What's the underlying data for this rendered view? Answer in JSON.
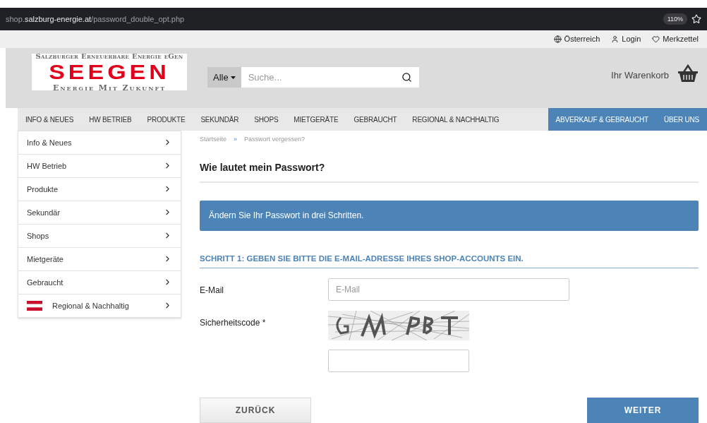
{
  "browser": {
    "url_host_prefix": "shop.",
    "url_domain": "salzburg-energie.at",
    "url_path": "/password_double_opt.php",
    "zoom": "110%"
  },
  "topbar": [
    {
      "label": "Österreich",
      "kind": "globe"
    },
    {
      "label": "Login",
      "kind": "user"
    },
    {
      "label": "Merkzettel",
      "kind": "heart"
    }
  ],
  "logo": {
    "top": "Salzburger Erneuerbare Energie eGen",
    "main": "SEEGEN",
    "bottom": "Energie Mit Zukunft"
  },
  "search": {
    "category": "Alle",
    "placeholder": "Suche..."
  },
  "cart": {
    "label": "Ihr Warenkorb"
  },
  "nav": [
    {
      "label": "INFO & NEUES",
      "highlighted": false
    },
    {
      "label": "HW BETRIEB",
      "highlighted": false
    },
    {
      "label": "PRODUKTE",
      "highlighted": false
    },
    {
      "label": "SEKUNDÄR",
      "highlighted": false
    },
    {
      "label": "SHOPS",
      "highlighted": false
    },
    {
      "label": "MIETGERÄTE",
      "highlighted": false
    },
    {
      "label": "GEBRAUCHT",
      "highlighted": false
    },
    {
      "label": "REGIONAL & NACHHALTIG",
      "highlighted": false
    },
    {
      "label": "ABVERKAUF & GEBRAUCHT",
      "highlighted": true
    },
    {
      "label": "ÜBER UNS",
      "highlighted": true
    }
  ],
  "sidebar": {
    "items": [
      {
        "label": "Info & Neues",
        "flag": false
      },
      {
        "label": "HW Betrieb",
        "flag": false
      },
      {
        "label": "Produkte",
        "flag": false
      },
      {
        "label": "Sekundär",
        "flag": false
      },
      {
        "label": "Shops",
        "flag": false
      },
      {
        "label": "Mietgeräte",
        "flag": false
      },
      {
        "label": "Gebraucht",
        "flag": false
      },
      {
        "label": "Regional & Nachhaltig",
        "flag": true
      }
    ]
  },
  "breadcrumb": {
    "items": [
      "Startseite",
      "Passwort vergessen?"
    ],
    "separator": "»"
  },
  "title": "Wie lautet mein Passwort?",
  "info": "Ändern Sie Ihr Passwort in drei Schritten.",
  "step": "SCHRITT 1: GEBEN SIE BITTE DIE E-MAIL-ADRESSE IHRES SHOP-ACCOUNTS EIN.",
  "form": {
    "email_label": "E-Mail",
    "email_placeholder": "E-Mail",
    "code_label": "Sicherheitscode *"
  },
  "buttons": {
    "back": "ZURÜCK",
    "next": "WEITER"
  }
}
